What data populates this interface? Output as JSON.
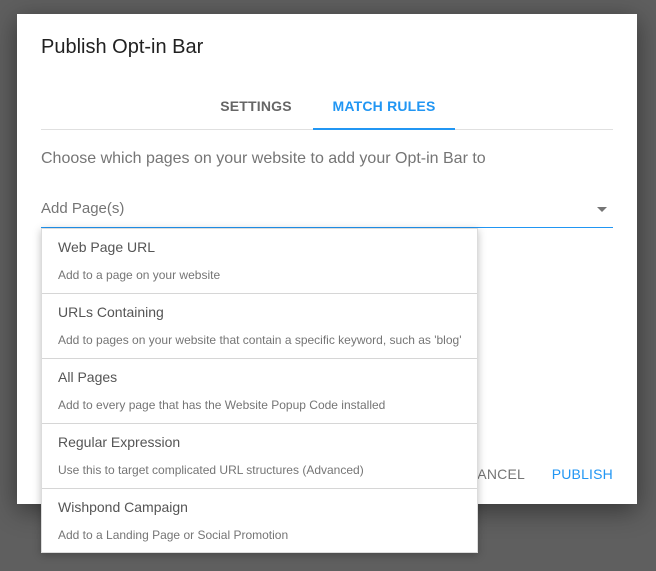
{
  "dialog": {
    "title": "Publish Opt-in Bar",
    "tabs": [
      {
        "label": "SETTINGS",
        "active": false
      },
      {
        "label": "MATCH RULES",
        "active": true
      }
    ],
    "description": "Choose which pages on your website to add your Opt-in Bar to",
    "page_select": {
      "placeholder": "Add Page(s)",
      "icon": "caret-down-icon"
    },
    "actions": {
      "cancel_label": "CANCEL",
      "publish_label": "PUBLISH"
    }
  },
  "dropdown": {
    "options": [
      {
        "label": "Web Page URL",
        "description": "Add to a page on your website"
      },
      {
        "label": "URLs Containing",
        "description": "Add to pages on your website that contain a specific keyword, such as 'blog'"
      },
      {
        "label": "All Pages",
        "description": "Add to every page that has the Website Popup Code installed"
      },
      {
        "label": "Regular Expression",
        "description": "Use this to target complicated URL structures (Advanced)"
      },
      {
        "label": "Wishpond Campaign",
        "description": "Add to a Landing Page or Social Promotion"
      }
    ]
  },
  "colors": {
    "accent": "#2196f3",
    "overlay": "#5f5f5f",
    "text_primary": "#212121",
    "text_secondary": "#757575"
  }
}
